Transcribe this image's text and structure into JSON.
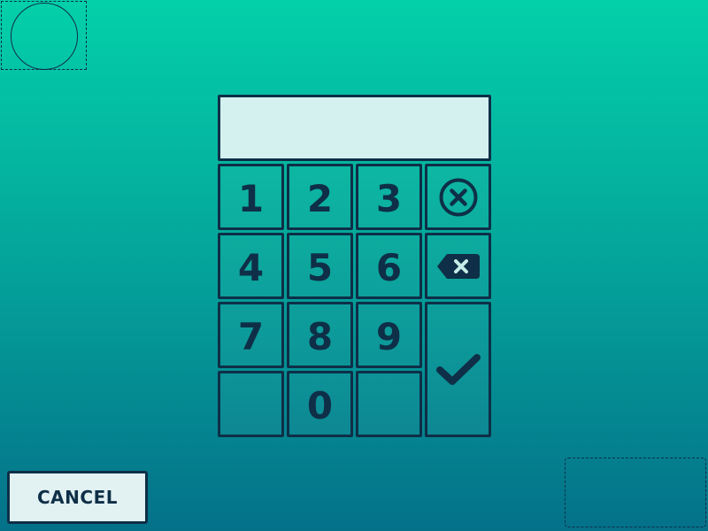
{
  "keypad": {
    "display_value": "",
    "keys": {
      "k1": "1",
      "k2": "2",
      "k3": "3",
      "k4": "4",
      "k5": "5",
      "k6": "6",
      "k7": "7",
      "k8": "8",
      "k9": "9",
      "k0": "0"
    },
    "icons": {
      "clear": "clear-circle-x-icon",
      "backspace": "backspace-icon",
      "confirm": "checkmark-icon"
    }
  },
  "footer": {
    "cancel_label": "CANCEL"
  },
  "colors": {
    "background_top": "#03d0a9",
    "background_bottom": "#047189",
    "stroke": "#0e2f47",
    "display_fill": "#d4f1ef",
    "button_fill": "#e2f1f2"
  }
}
